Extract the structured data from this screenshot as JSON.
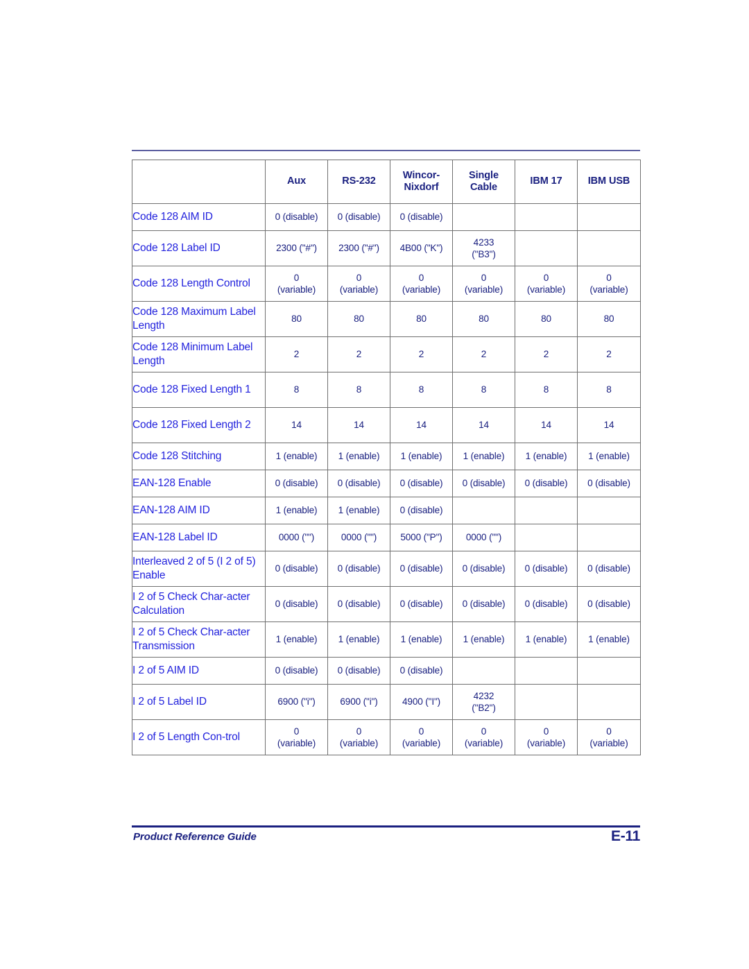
{
  "document": {
    "footer_left": "Product Reference Guide",
    "footer_page": "E-11",
    "rule_color": "#5b5ea0",
    "label_color": "#2222dd",
    "value_color": "#1a2080"
  },
  "table": {
    "columns": [
      {
        "key": "label",
        "label": ""
      },
      {
        "key": "aux",
        "label": "Aux"
      },
      {
        "key": "rs232",
        "label": "RS-232"
      },
      {
        "key": "wincor",
        "label": "Wincor-\nNixdorf"
      },
      {
        "key": "single",
        "label": "Single\nCable"
      },
      {
        "key": "ibm17",
        "label": "IBM 17"
      },
      {
        "key": "ibmusb",
        "label": "IBM USB"
      }
    ],
    "rows": [
      {
        "label": "Code 128 AIM ID",
        "values": [
          "0 (disable)",
          "0 (disable)",
          "0 (disable)",
          "",
          "",
          ""
        ]
      },
      {
        "label": "Code 128 Label ID",
        "values": [
          "2300 (\"#\")",
          "2300 (\"#\")",
          "4B00 (\"K\")",
          "4233\n(\"B3\")",
          "",
          ""
        ]
      },
      {
        "label": "Code 128 Length Control",
        "values": [
          "0\n(variable)",
          "0\n(variable)",
          "0\n(variable)",
          "0\n(variable)",
          "0\n(variable)",
          "0\n(variable)"
        ]
      },
      {
        "label": "Code 128 Maximum Label Length",
        "values": [
          "80",
          "80",
          "80",
          "80",
          "80",
          "80"
        ]
      },
      {
        "label": "Code 128 Minimum Label Length",
        "values": [
          "2",
          "2",
          "2",
          "2",
          "2",
          "2"
        ]
      },
      {
        "label": "Code 128 Fixed Length 1",
        "values": [
          "8",
          "8",
          "8",
          "8",
          "8",
          "8"
        ]
      },
      {
        "label": "Code 128 Fixed Length 2",
        "values": [
          "14",
          "14",
          "14",
          "14",
          "14",
          "14"
        ]
      },
      {
        "label": "Code 128 Stitching",
        "values": [
          "1 (enable)",
          "1 (enable)",
          "1 (enable)",
          "1 (enable)",
          "1 (enable)",
          "1 (enable)"
        ]
      },
      {
        "label": "EAN-128 Enable",
        "values": [
          "0 (disable)",
          "0 (disable)",
          "0 (disable)",
          "0 (disable)",
          "0 (disable)",
          "0 (disable)"
        ]
      },
      {
        "label": "EAN-128 AIM ID",
        "values": [
          "1 (enable)",
          "1 (enable)",
          "0 (disable)",
          "",
          "",
          ""
        ]
      },
      {
        "label": "EAN-128 Label ID",
        "values": [
          "0000 (\"\")",
          "0000 (\"\")",
          "5000 (\"P\")",
          "0000 (\"\")",
          "",
          ""
        ]
      },
      {
        "label": "Interleaved 2 of 5 (I 2 of 5) Enable",
        "values": [
          "0 (disable)",
          "0 (disable)",
          "0 (disable)",
          "0 (disable)",
          "0 (disable)",
          "0 (disable)"
        ]
      },
      {
        "label": "I 2 of 5 Check Char-acter Calculation",
        "values": [
          "0 (disable)",
          "0 (disable)",
          "0 (disable)",
          "0 (disable)",
          "0 (disable)",
          "0 (disable)"
        ]
      },
      {
        "label": "I 2 of 5 Check Char-acter Transmission",
        "values": [
          "1 (enable)",
          "1 (enable)",
          "1 (enable)",
          "1 (enable)",
          "1 (enable)",
          "1 (enable)"
        ]
      },
      {
        "label": "I 2 of 5 AIM ID",
        "values": [
          "0 (disable)",
          "0 (disable)",
          "0 (disable)",
          "",
          "",
          ""
        ]
      },
      {
        "label": "I 2 of 5 Label ID",
        "values": [
          "6900 (\"i\")",
          "6900 (\"i\")",
          "4900 (\"I\")",
          "4232\n(\"B2\")",
          "",
          ""
        ]
      },
      {
        "label": "I 2 of 5 Length Con-trol",
        "values": [
          "0\n(variable)",
          "0\n(variable)",
          "0\n(variable)",
          "0\n(variable)",
          "0\n(variable)",
          "0\n(variable)"
        ]
      }
    ]
  }
}
